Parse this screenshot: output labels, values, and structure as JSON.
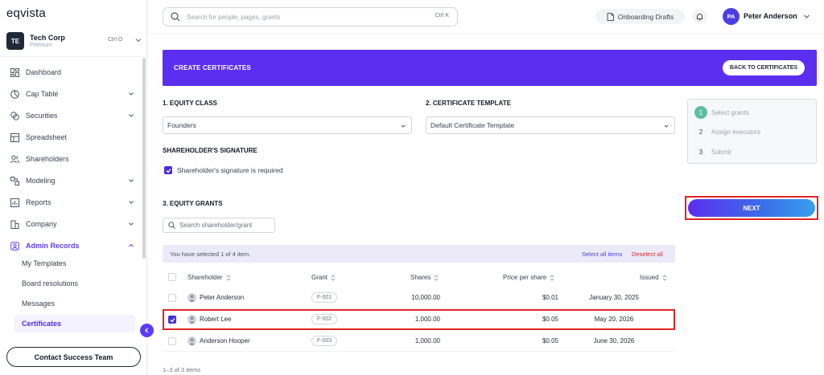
{
  "app": {
    "logo": "eqvista"
  },
  "org": {
    "initials": "TE",
    "name": "Tech Corp",
    "plan": "Premium",
    "shortcut": "Ctrl O"
  },
  "sidebar": {
    "items": [
      {
        "label": "Dashboard",
        "icon": "dashboard-icon",
        "has_chevron": false
      },
      {
        "label": "Cap Table",
        "icon": "pie-chart-icon",
        "has_chevron": true
      },
      {
        "label": "Securities",
        "icon": "securities-icon",
        "has_chevron": true
      },
      {
        "label": "Spreadsheet",
        "icon": "spreadsheet-icon",
        "has_chevron": false
      },
      {
        "label": "Shareholders",
        "icon": "users-icon",
        "has_chevron": false
      },
      {
        "label": "Modeling",
        "icon": "modeling-icon",
        "has_chevron": true
      },
      {
        "label": "Reports",
        "icon": "reports-icon",
        "has_chevron": true
      },
      {
        "label": "Company",
        "icon": "company-icon",
        "has_chevron": true
      },
      {
        "label": "Admin Records",
        "icon": "admin-records-icon",
        "has_chevron": true,
        "expanded": true
      }
    ],
    "sub_items": [
      "My Templates",
      "Board resolutions",
      "Messages",
      "Certificates"
    ],
    "active_sub": "Certificates",
    "contact_label": "Contact Success Team"
  },
  "topbar": {
    "search_placeholder": "Search for people, pages, grants",
    "search_shortcut": "Ctrl K",
    "drafts_label": "Onboarding Drafts",
    "user_initials": "PA",
    "user_name": "Peter Anderson"
  },
  "banner": {
    "title": "CREATE CERTIFICATES",
    "back_label": "BACK TO CERTIFICATES"
  },
  "form": {
    "equity_class_label": "1. EQUITY CLASS",
    "equity_class_value": "Founders",
    "template_label": "2. CERTIFICATE TEMPLATE",
    "template_value": "Default Certificate Template",
    "signature_label": "SHAREHOLDER'S SIGNATURE",
    "signature_checkbox_label": "Shareholder's signature is required",
    "signature_required": true,
    "grants_label": "3. EQUITY GRANTS",
    "grant_search_placeholder": "Search shareholder/grant"
  },
  "selection": {
    "text": "You have selected 1 of 4 item.",
    "select_all": "Select all items",
    "deselect_all": "Deselect all"
  },
  "table": {
    "columns": {
      "shareholder": "Shareholder",
      "grant": "Grant",
      "shares": "Shares",
      "price": "Price per share",
      "issued": "Issued"
    },
    "rows": [
      {
        "shareholder": "Peter Anderson",
        "grant": "F-001",
        "shares": "10,000.00",
        "price": "$0.01",
        "issued": "January 30, 2025",
        "checked": false
      },
      {
        "shareholder": "Robert Lee",
        "grant": "F-002",
        "shares": "1,000.00",
        "price": "$0.05",
        "issued": "May 20, 2026",
        "checked": true
      },
      {
        "shareholder": "Anderson Hooper",
        "grant": "F-003",
        "shares": "1,000.00",
        "price": "$0.05",
        "issued": "June 30, 2026",
        "checked": false
      }
    ],
    "count": "1–3 of 3 items"
  },
  "steps": [
    {
      "num": "1",
      "label": "Select grants",
      "done": true
    },
    {
      "num": "2",
      "label": "Assign executors",
      "done": false
    },
    {
      "num": "3",
      "label": "Submit",
      "done": false
    }
  ],
  "next_label": "NEXT",
  "colors": {
    "brand": "#5b2ef0",
    "accent": "#4c2ce0",
    "danger": "#e02424",
    "step_done": "#5bbfa0"
  }
}
